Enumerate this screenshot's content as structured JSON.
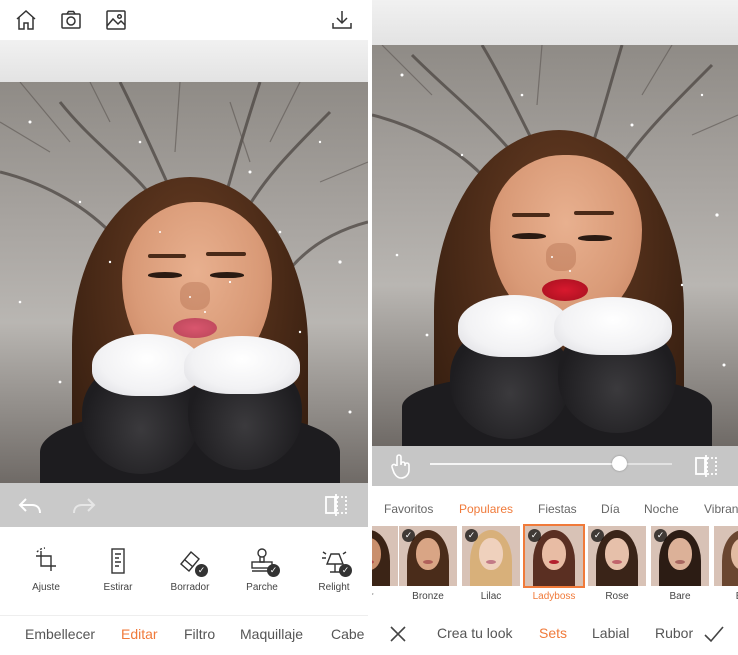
{
  "editor": {
    "topbar": {
      "icons": [
        "home-icon",
        "camera-icon",
        "gallery-icon",
        "download-icon"
      ]
    },
    "tools": [
      {
        "label": "Ajuste",
        "icon": "crop-rotate-icon",
        "badge": false
      },
      {
        "label": "Estirar",
        "icon": "stretch-icon",
        "badge": false
      },
      {
        "label": "Borrador",
        "icon": "eraser-icon",
        "badge": true
      },
      {
        "label": "Parche",
        "icon": "stamp-icon",
        "badge": true
      },
      {
        "label": "Relight",
        "icon": "lamp-icon",
        "badge": true
      }
    ],
    "nav": [
      {
        "label": "Embellecer",
        "active": false
      },
      {
        "label": "Editar",
        "active": true
      },
      {
        "label": "Filtro",
        "active": false
      },
      {
        "label": "Maquillaje",
        "active": false
      },
      {
        "label": "Cabe",
        "active": false
      }
    ]
  },
  "makeup": {
    "slider": {
      "value": 0.79
    },
    "categories": [
      {
        "label": "Favoritos",
        "active": false
      },
      {
        "label": "Populares",
        "active": true
      },
      {
        "label": "Fiestas",
        "active": false
      },
      {
        "label": "Día",
        "active": false
      },
      {
        "label": "Noche",
        "active": false
      },
      {
        "label": "Vibran",
        "active": false
      }
    ],
    "looks": [
      {
        "label": "ur",
        "checked": false,
        "active": false,
        "skin": "#c98f6c",
        "hair": "#3b2416",
        "lip": "#b0494a"
      },
      {
        "label": "Bronze",
        "checked": true,
        "active": false,
        "skin": "#d9a585",
        "hair": "#4a2c1a",
        "lip": "#b0605a"
      },
      {
        "label": "Lilac",
        "checked": true,
        "active": false,
        "skin": "#efd1bd",
        "hair": "#d8b07a",
        "lip": "#c27a86"
      },
      {
        "label": "Ladyboss",
        "checked": true,
        "active": true,
        "skin": "#e8bca4",
        "hair": "#5a2f22",
        "lip": "#b3202e"
      },
      {
        "label": "Rose",
        "checked": true,
        "active": false,
        "skin": "#e6c0aa",
        "hair": "#3a2418",
        "lip": "#c0646c"
      },
      {
        "label": "Bare",
        "checked": true,
        "active": false,
        "skin": "#dcb198",
        "hair": "#2c1c14",
        "lip": "#a86660"
      },
      {
        "label": "Blu",
        "checked": false,
        "active": false,
        "skin": "#e2bba2",
        "hair": "#6a4630",
        "lip": "#b55a5e"
      }
    ],
    "bottom": [
      {
        "label": "Crea tu look",
        "active": false
      },
      {
        "label": "Sets",
        "active": true
      },
      {
        "label": "Labial",
        "active": false
      },
      {
        "label": "Rubor",
        "active": false
      }
    ]
  },
  "colors": {
    "accent": "#f07a3a",
    "lips_left": "#d9566e",
    "lips_right": "#d8192e"
  }
}
